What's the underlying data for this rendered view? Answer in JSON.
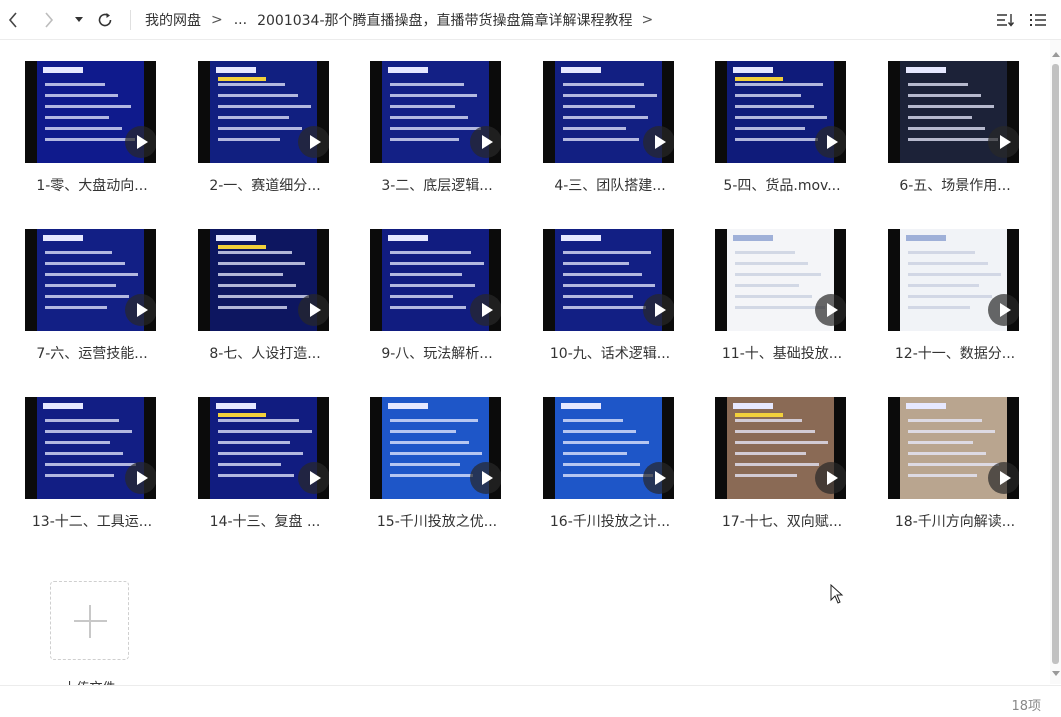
{
  "toolbar": {
    "back_icon": "chevron-left-icon",
    "forward_icon": "chevron-right-icon",
    "dropdown_icon": "caret-down-icon",
    "refresh_icon": "refresh-icon",
    "breadcrumb": {
      "root": "我的网盘",
      "separator": ">",
      "ellipsis": "...",
      "current": "2001034-那个腾直播操盘，直播带货操盘篇章详解课程教程",
      "tail": ">"
    },
    "sort_icon": "sort-icon",
    "list_view_icon": "list-view-icon"
  },
  "files": [
    {
      "label": "1-零、大盘动向...",
      "theme": "#0f1a8c"
    },
    {
      "label": "2-一、赛道细分...",
      "theme": "#111f80"
    },
    {
      "label": "3-二、底层逻辑...",
      "theme": "#132085"
    },
    {
      "label": "4-三、团队搭建...",
      "theme": "#121f82"
    },
    {
      "label": "5-四、货品.mov...",
      "theme": "#0f1b7a"
    },
    {
      "label": "6-五、场景作用...",
      "theme": "#1c2238"
    },
    {
      "label": "7-六、运营技能...",
      "theme": "#121f85"
    },
    {
      "label": "8-七、人设打造...",
      "theme": "#0d1660"
    },
    {
      "label": "9-八、玩法解析...",
      "theme": "#111c80"
    },
    {
      "label": "10-九、话术逻辑...",
      "theme": "#121f84"
    },
    {
      "label": "11-十、基础投放...",
      "theme": "#f4f5f8"
    },
    {
      "label": "12-十一、数据分...",
      "theme": "#f1f3f7"
    },
    {
      "label": "13-十二、工具运...",
      "theme": "#121e84"
    },
    {
      "label": "14-十三、复盘 ...",
      "theme": "#111c80"
    },
    {
      "label": "15-千川投放之优...",
      "theme": "#1e56c8"
    },
    {
      "label": "16-千川投放之计...",
      "theme": "#1e56c8"
    },
    {
      "label": "17-十七、双向赋...",
      "theme": "#8a6a55"
    },
    {
      "label": "18-千川方向解读...",
      "theme": "#b9a58f"
    }
  ],
  "upload": {
    "label": "上传文件",
    "icon": "plus-icon"
  },
  "status": {
    "count": "18项"
  },
  "play_icon": "play-icon"
}
